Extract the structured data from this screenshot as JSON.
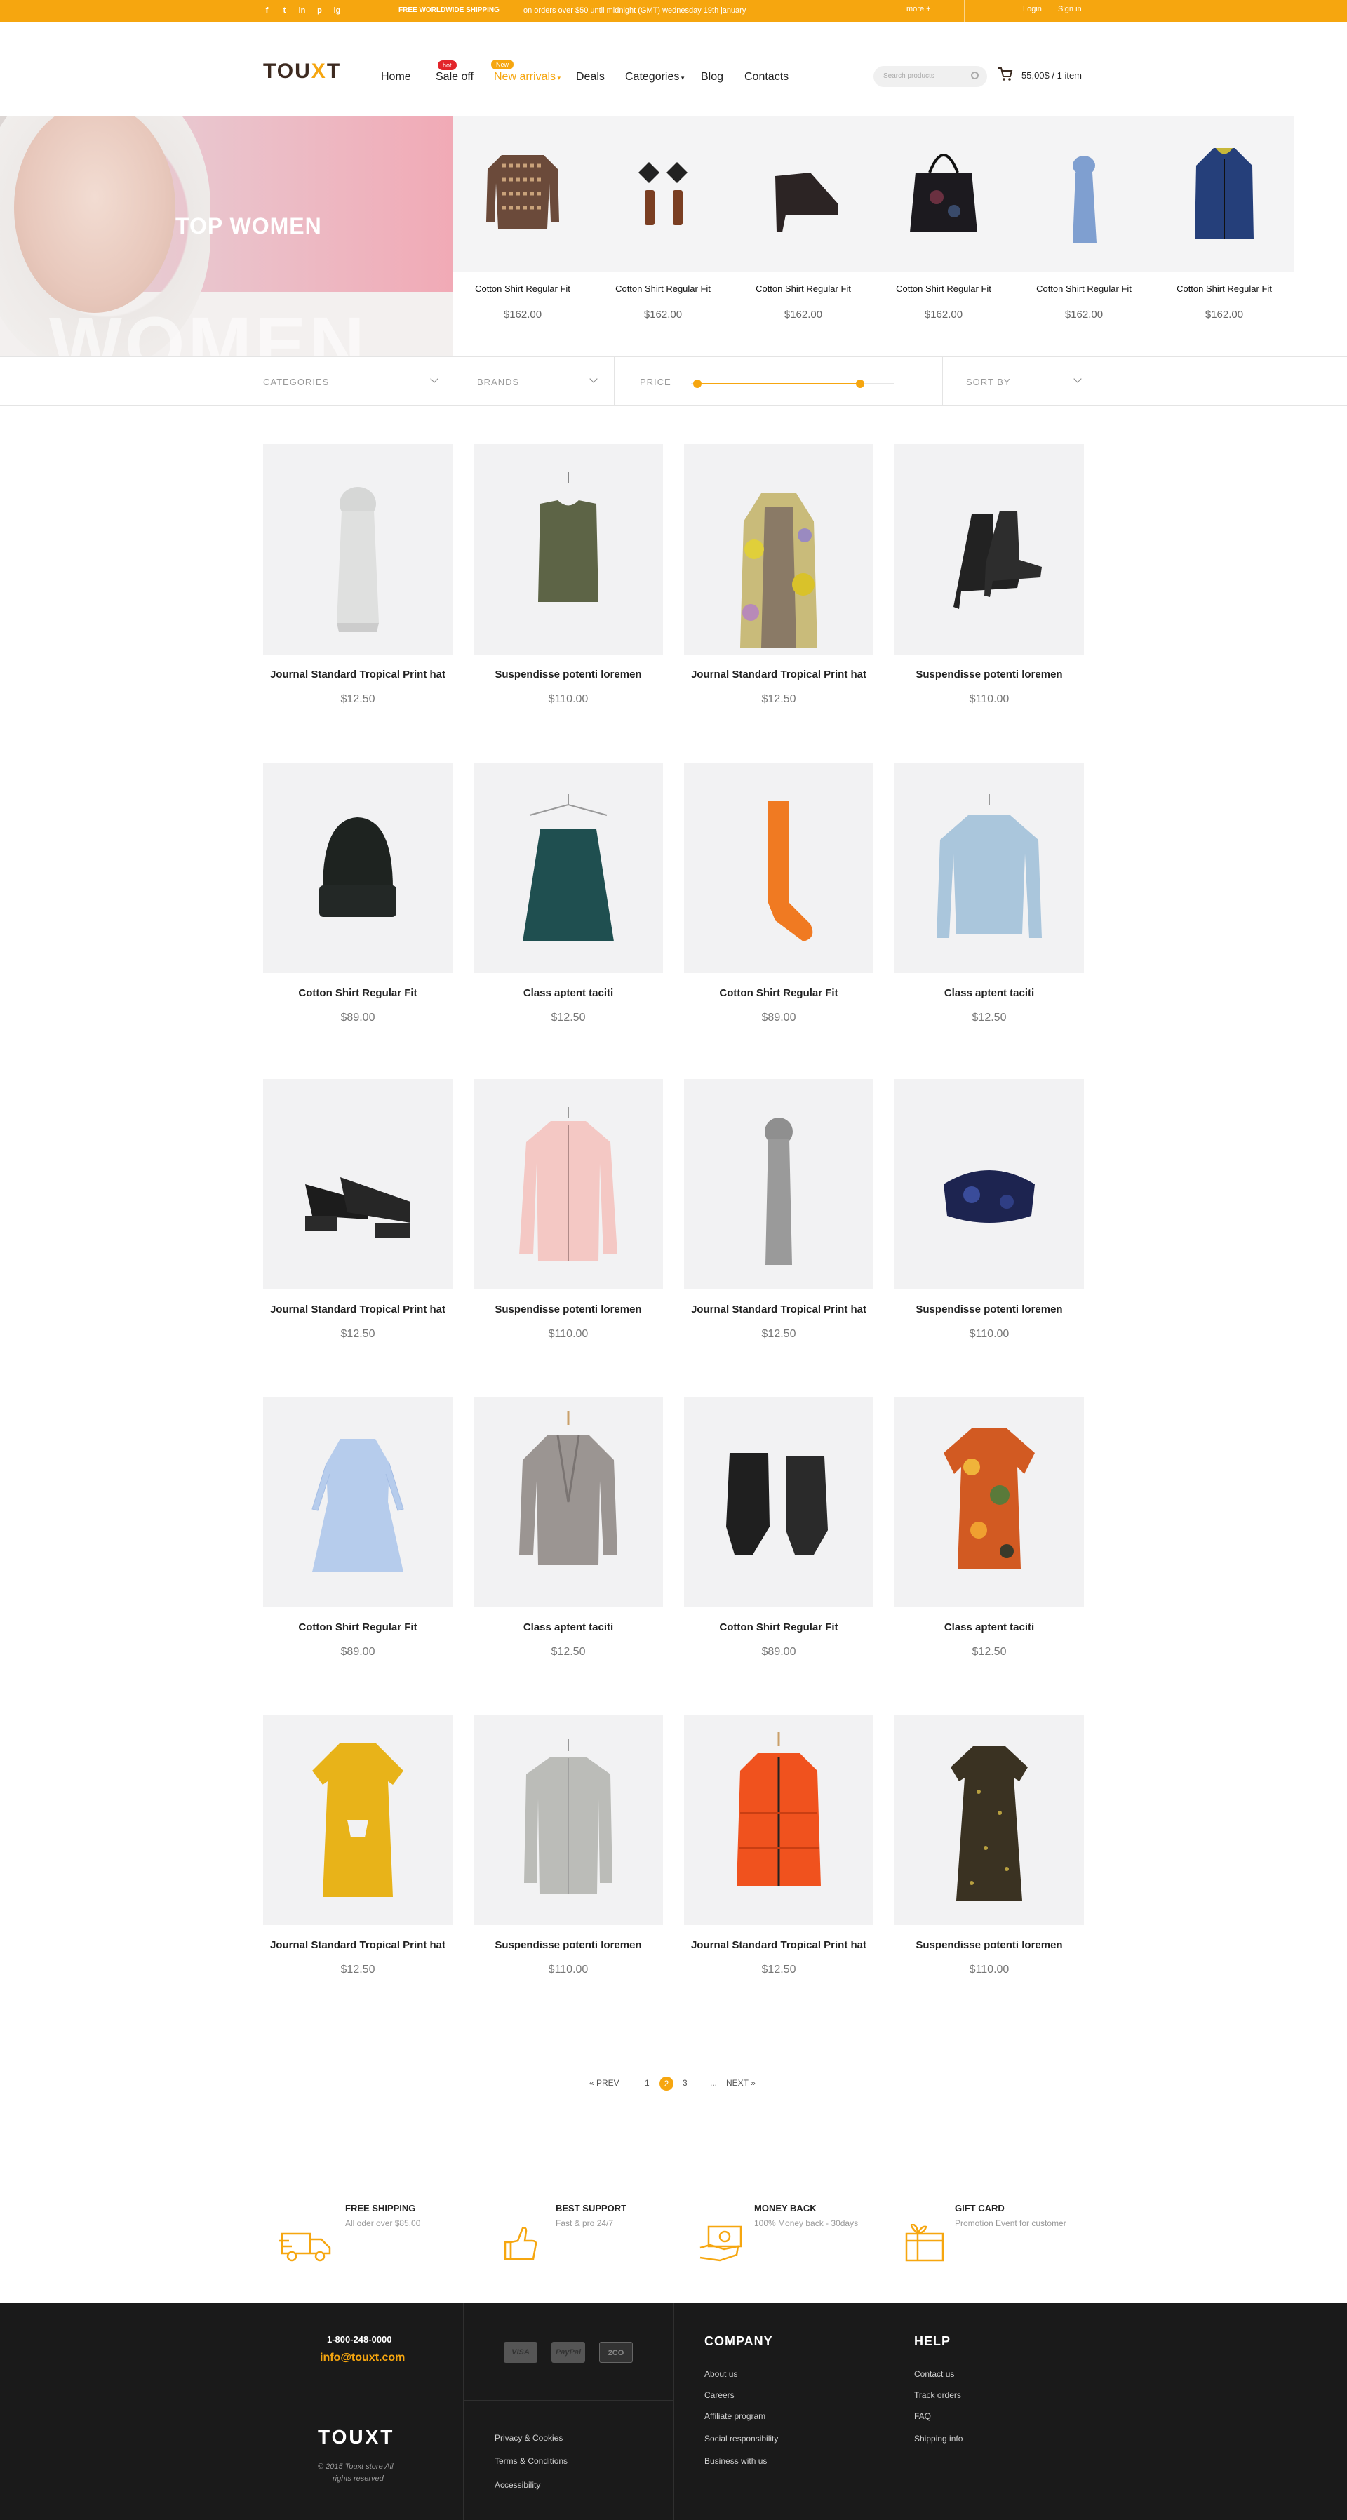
{
  "topbar": {
    "social": [
      "f",
      "t",
      "in",
      "p",
      "ig"
    ],
    "shipping_title": "FREE WORLDWIDE SHIPPING",
    "shipping_note": "on orders over $50 until midnight (GMT) wednesday 19th january",
    "more": "more +",
    "login": "Login",
    "signin": "Sign in"
  },
  "header": {
    "logo_a": "TOU",
    "logo_x": "X",
    "logo_b": "T",
    "nav": [
      {
        "label": "Home"
      },
      {
        "label": "Sale off",
        "badge": "hot"
      },
      {
        "label": "New arrivals",
        "badge": "New"
      },
      {
        "label": "Deals"
      },
      {
        "label": "Categories"
      },
      {
        "label": "Blog"
      },
      {
        "label": "Contacts"
      }
    ],
    "search_placeholder": "Search products",
    "cart": "55,00$ / 1 item"
  },
  "hero": {
    "title": "TOP WOMEN",
    "watermark": "WOMEN"
  },
  "strip": [
    {
      "name": "Cotton Shirt Regular Fit",
      "price": "$162.00"
    },
    {
      "name": "Cotton Shirt Regular Fit",
      "price": "$162.00"
    },
    {
      "name": "Cotton Shirt Regular Fit",
      "price": "$162.00"
    },
    {
      "name": "Cotton Shirt Regular Fit",
      "price": "$162.00"
    },
    {
      "name": "Cotton Shirt Regular Fit",
      "price": "$162.00"
    },
    {
      "name": "Cotton Shirt Regular Fit",
      "price": "$162.00"
    }
  ],
  "filters": {
    "categories": "CATEGORIES",
    "brands": "BRANDS",
    "price": "PRICE",
    "price_range": [
      0.03,
      0.83
    ],
    "sort": "SORT BY"
  },
  "products": [
    {
      "name": "Journal Standard Tropical Print hat",
      "price": "$12.50"
    },
    {
      "name": "Suspendisse potenti loremen",
      "price": "$110.00"
    },
    {
      "name": "Journal Standard Tropical Print hat",
      "price": "$12.50"
    },
    {
      "name": "Suspendisse potenti loremen",
      "price": "$110.00"
    },
    {
      "name": "Cotton Shirt Regular Fit",
      "price": "$89.00"
    },
    {
      "name": "Class aptent taciti",
      "price": "$12.50"
    },
    {
      "name": "Cotton Shirt Regular Fit",
      "price": "$89.00"
    },
    {
      "name": "Class aptent taciti",
      "price": "$12.50"
    },
    {
      "name": "Journal Standard Tropical Print hat",
      "price": "$12.50"
    },
    {
      "name": "Suspendisse potenti loremen",
      "price": "$110.00"
    },
    {
      "name": "Journal Standard Tropical Print hat",
      "price": "$12.50"
    },
    {
      "name": "Suspendisse potenti loremen",
      "price": "$110.00"
    },
    {
      "name": "Cotton Shirt Regular Fit",
      "price": "$89.00"
    },
    {
      "name": "Class aptent taciti",
      "price": "$12.50"
    },
    {
      "name": "Cotton Shirt Regular Fit",
      "price": "$89.00"
    },
    {
      "name": "Class aptent taciti",
      "price": "$12.50"
    },
    {
      "name": "Journal Standard Tropical Print hat",
      "price": "$12.50"
    },
    {
      "name": "Suspendisse potenti loremen",
      "price": "$110.00"
    },
    {
      "name": "Journal Standard Tropical Print hat",
      "price": "$12.50"
    },
    {
      "name": "Suspendisse potenti loremen",
      "price": "$110.00"
    }
  ],
  "pagination": {
    "prev": "« PREV",
    "pages": [
      "1",
      "2",
      "3"
    ],
    "ellipsis": "...",
    "next": "NEXT »",
    "current": "2"
  },
  "services": [
    {
      "title": "FREE SHIPPING",
      "sub": "All oder over $85.00"
    },
    {
      "title": "BEST SUPPORT",
      "sub": "Fast & pro 24/7"
    },
    {
      "title": "MONEY BACK",
      "sub": "100% Money back - 30days"
    },
    {
      "title": "GIFT CARD",
      "sub": "Promotion Event for customer"
    }
  ],
  "footer": {
    "phone": "1-800-248-0000",
    "email": "info@touxt.com",
    "payments": [
      "VISA",
      "PayPal",
      "2CO"
    ],
    "logo": "TOUXT",
    "copyright_1": "© 2015 Touxt store All",
    "copyright_2": "rights reserved",
    "legal": [
      "Privacy & Cookies",
      "Terms & Conditions",
      "Accessibility"
    ],
    "company_title": "COMPANY",
    "company": [
      "About us",
      "Careers",
      "Affiliate program",
      "Social responsibility",
      "Business with us"
    ],
    "help_title": "HELP",
    "help": [
      "Contact us",
      "Track orders",
      "FAQ",
      "Shipping info"
    ]
  },
  "colors": {
    "accent": "#f6a60f",
    "hot_badge": "#e2252b",
    "footer_bg": "#1a1a1a"
  }
}
